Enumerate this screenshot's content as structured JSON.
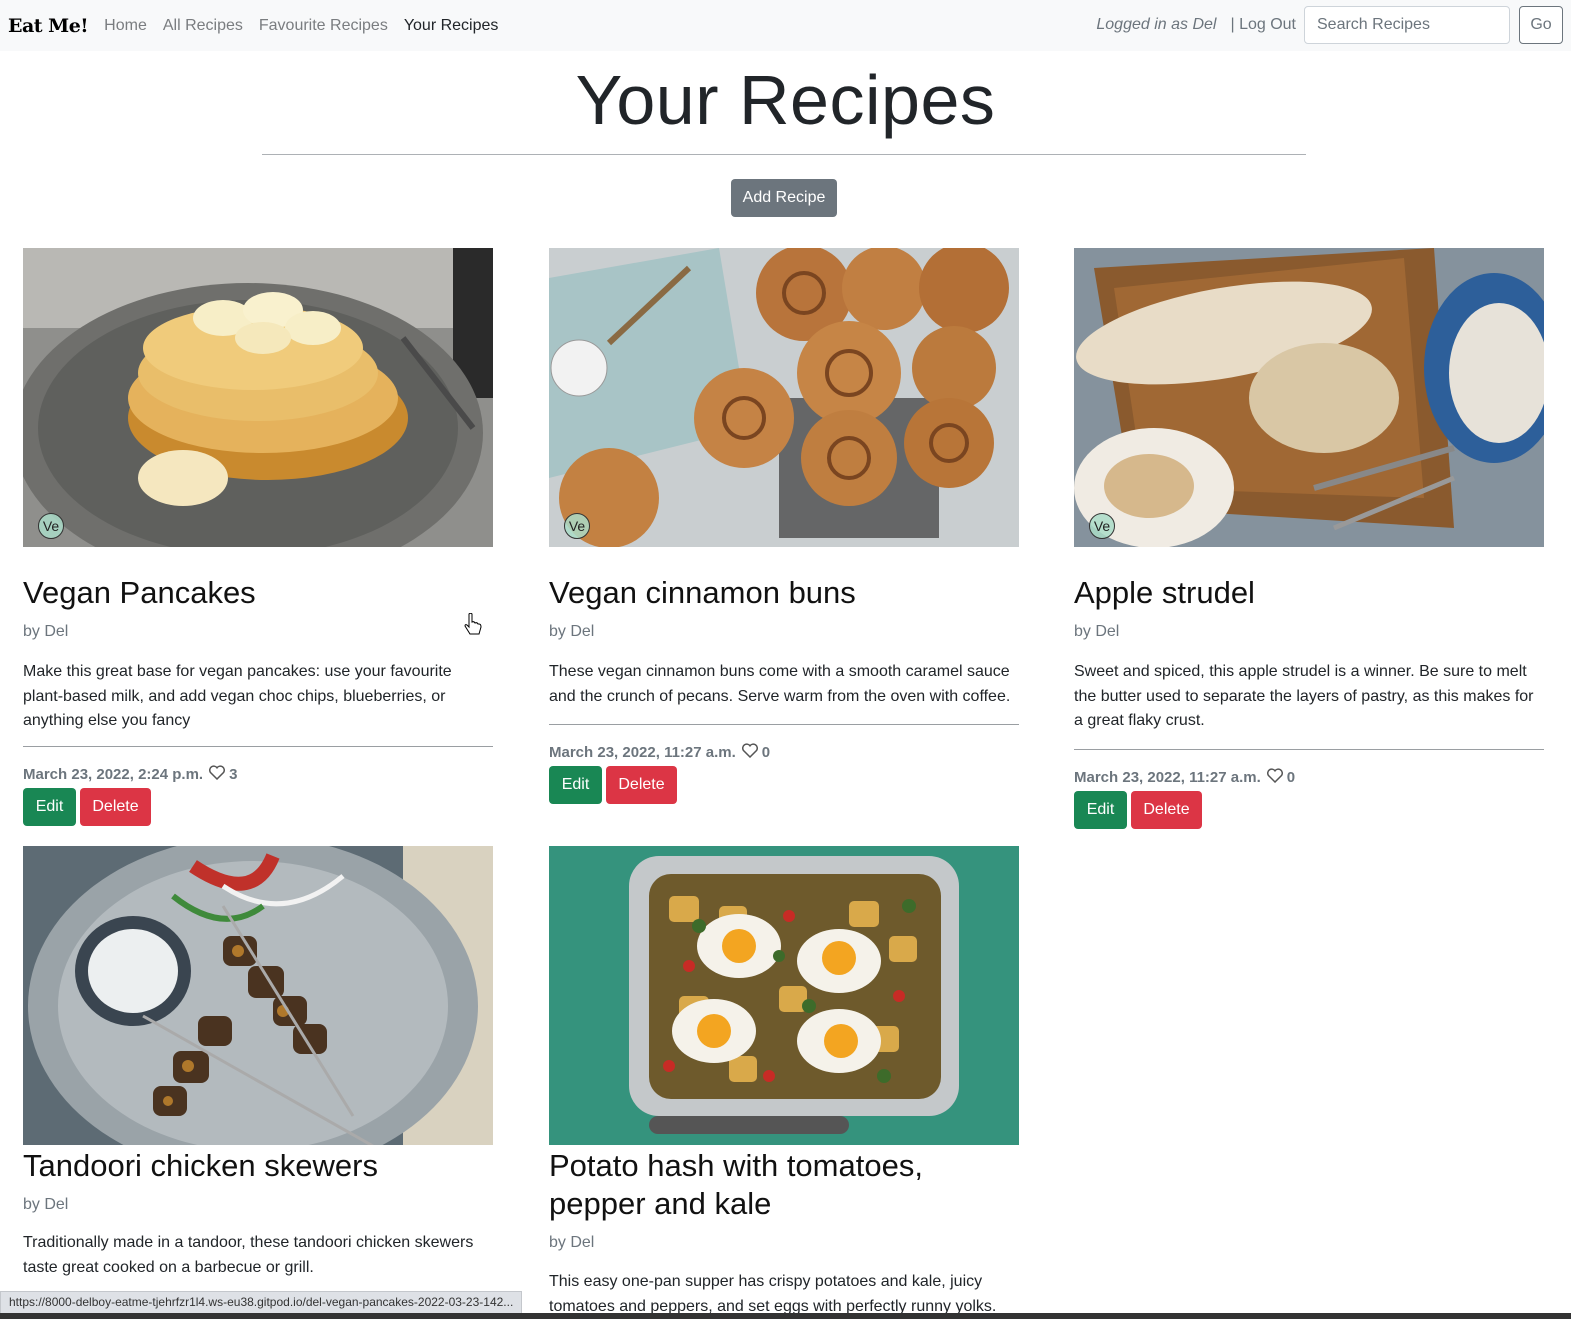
{
  "nav": {
    "brand": "Eat Me!",
    "links": [
      "Home",
      "All Recipes",
      "Favourite Recipes",
      "Your Recipes"
    ],
    "logged_in": "Logged in as Del",
    "logout": "| Log Out",
    "search_placeholder": "Search Recipes",
    "go": "Go"
  },
  "page": {
    "title": "Your Recipes",
    "add_button": "Add Recipe"
  },
  "cards": [
    {
      "title": "Vegan Pancakes",
      "author": "by Del",
      "badge": "Ve",
      "description": "Make this great base for vegan pancakes: use your favourite plant-based milk, and add vegan choc chips, blueberries, or anything else you fancy",
      "date": "March 23, 2022, 2:24 p.m.",
      "likes": "3",
      "edit": "Edit",
      "delete": "Delete",
      "image": "pancakes"
    },
    {
      "title": "Vegan cinnamon buns",
      "author": "by Del",
      "badge": "Ve",
      "description": "These vegan cinnamon buns come with a smooth caramel sauce and the crunch of pecans. Serve warm from the oven with coffee.",
      "date": "March 23, 2022, 11:27 a.m.",
      "likes": "0",
      "edit": "Edit",
      "delete": "Delete",
      "image": "cinnamon-buns"
    },
    {
      "title": "Apple strudel",
      "author": "by Del",
      "badge": "Ve",
      "description": "Sweet and spiced, this apple strudel is a winner. Be sure to melt the butter used to separate the layers of pastry, as this makes for a great flaky crust.",
      "date": "March 23, 2022, 11:27 a.m.",
      "likes": "0",
      "edit": "Edit",
      "delete": "Delete",
      "image": "apple-strudel"
    },
    {
      "title": "Tandoori chicken skewers",
      "author": "by Del",
      "description": "Traditionally made in a tandoor, these tandoori chicken skewers taste great cooked on a barbecue or grill.",
      "image": "tandoori-skewers"
    },
    {
      "title": "Potato hash with tomatoes, pepper and kale",
      "author": "by Del",
      "description": "This easy one-pan supper has crispy potatoes and kale, juicy tomatoes and peppers, and set eggs with perfectly runny yolks.",
      "image": "potato-hash"
    }
  ],
  "status_bar": "https://8000-delboy-eatme-tjehrfzr1l4.ws-eu38.gitpod.io/del-vegan-pancakes-2022-03-23-142..."
}
